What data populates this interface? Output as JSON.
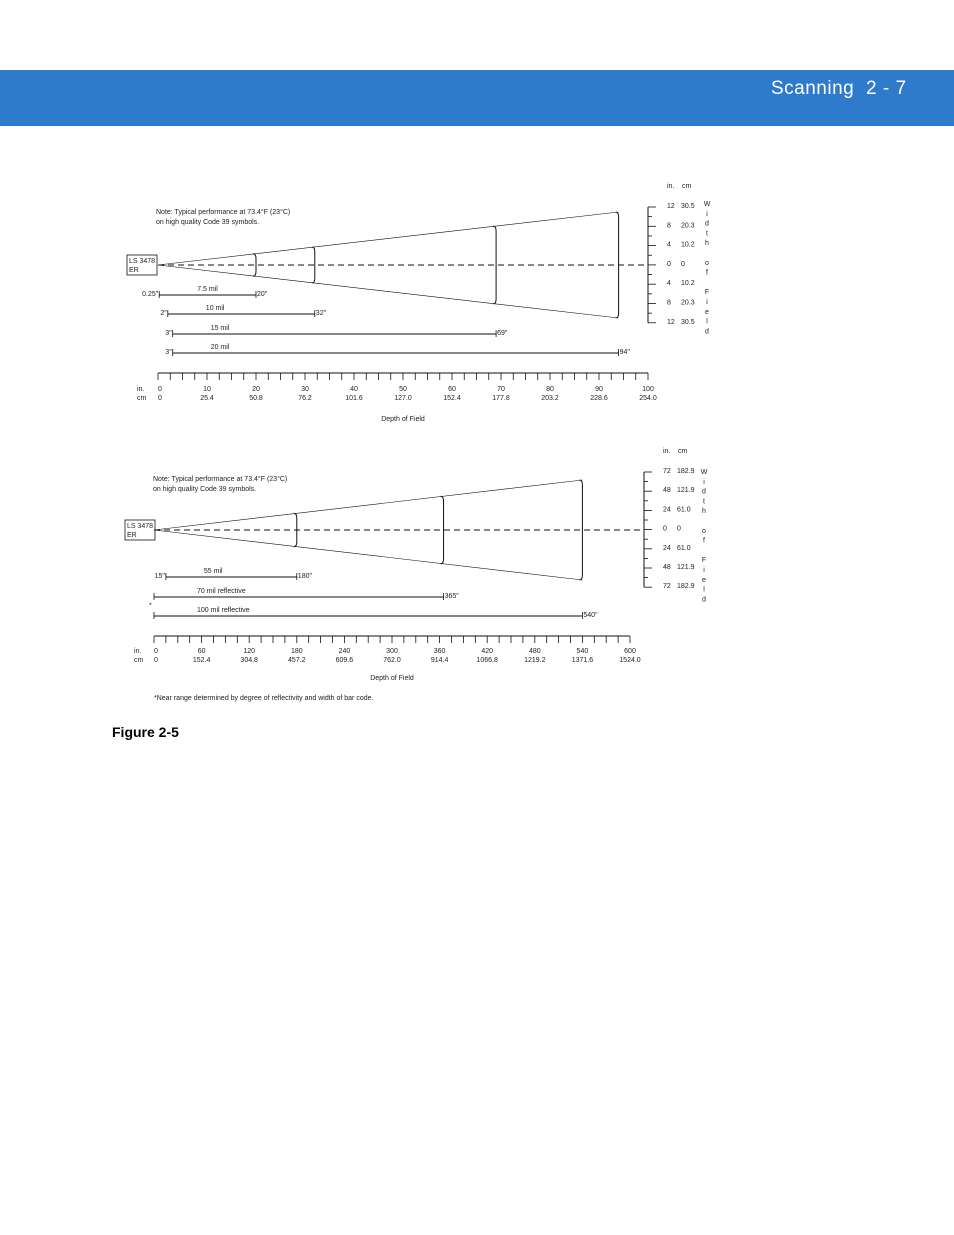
{
  "header": {
    "section": "Scanning",
    "page": "2 - 7",
    "color": "#2f7bcb"
  },
  "figure_label": "Figure 2-5",
  "diagrams": [
    {
      "note": [
        "Note: Typical performance at 73.4°F (23°C)",
        "on high quality Code 39 symbols."
      ],
      "scanner_label": [
        "LS 3478",
        "ER"
      ],
      "x_axis": {
        "min": 0,
        "max": 100,
        "minor_step": 2.5,
        "label": "Depth of Field",
        "unit_in": "in.",
        "unit_cm": "cm",
        "ticks_in": [
          "0",
          "10",
          "20",
          "30",
          "40",
          "50",
          "60",
          "70",
          "80",
          "90",
          "100"
        ],
        "ticks_cm": [
          "0",
          "25.4",
          "50.8",
          "76.2",
          "101.6",
          "127.0",
          "152.4",
          "177.8",
          "203.2",
          "228.6",
          "254.0"
        ]
      },
      "width_axis": {
        "unit_in": "in.",
        "unit_cm": "cm",
        "title_letters": [
          "W",
          "i",
          "d",
          "t",
          "h",
          "",
          "o",
          "f",
          "",
          "F",
          "i",
          "e",
          "l",
          "d"
        ],
        "ticks_in": [
          "12",
          "8",
          "4",
          "0",
          "4",
          "8",
          "12"
        ],
        "ticks_cm": [
          "30.5",
          "20.3",
          "10.2",
          "0",
          "10.2",
          "20.3",
          "30.5"
        ]
      },
      "beam_end": 94,
      "arcs": [
        20,
        32,
        69,
        94
      ],
      "ranges": [
        {
          "label": "7.5 mil",
          "near": 0.25,
          "far": 20,
          "near_label": "0.25\"",
          "far_label": "20\""
        },
        {
          "label": "10 mil",
          "near": 2,
          "far": 32,
          "near_label": "2\"",
          "far_label": "32\""
        },
        {
          "label": "15 mil",
          "near": 3,
          "far": 69,
          "near_label": "3\"",
          "far_label": "69\""
        },
        {
          "label": "20 mil",
          "near": 3,
          "far": 94,
          "near_label": "3\"",
          "far_label": "94\""
        }
      ]
    },
    {
      "note": [
        "Note: Typical performance at 73.4°F (23°C)",
        "on high quality Code 39 symbols."
      ],
      "scanner_label": [
        "LS 3478",
        "ER"
      ],
      "x_axis": {
        "min": 0,
        "max": 600,
        "minor_step": 15,
        "label": "Depth of Field",
        "unit_in": "in.",
        "unit_cm": "cm",
        "ticks_in": [
          "0",
          "60",
          "120",
          "180",
          "240",
          "300",
          "360",
          "420",
          "480",
          "540",
          "600"
        ],
        "ticks_cm": [
          "0",
          "152.4",
          "304.8",
          "457.2",
          "609.6",
          "762.0",
          "914.4",
          "1066.8",
          "1219.2",
          "1371.6",
          "1524.0"
        ]
      },
      "width_axis": {
        "unit_in": "in.",
        "unit_cm": "cm",
        "title_letters": [
          "W",
          "i",
          "d",
          "t",
          "h",
          "",
          "o",
          "f",
          "",
          "F",
          "i",
          "e",
          "l",
          "d"
        ],
        "ticks_in": [
          "72",
          "48",
          "24",
          "0",
          "24",
          "48",
          "72"
        ],
        "ticks_cm": [
          "182.9",
          "121.9",
          "61.0",
          "0",
          "61.0",
          "121.9",
          "182.9"
        ]
      },
      "beam_end": 540,
      "arcs": [
        180,
        365,
        540
      ],
      "ranges": [
        {
          "label": "55 mil",
          "near": 15,
          "far": 180,
          "near_label": "15\"",
          "far_label": "180\""
        },
        {
          "label": "70 mil reflective",
          "near": 0,
          "far": 365,
          "near_label": "",
          "far_label": "365\""
        },
        {
          "label": "100 mil reflective",
          "near": 0,
          "far": 540,
          "near_label": "",
          "far_label": "540\""
        }
      ],
      "asterisk": "*",
      "footnote": "*Near range determined by degree of reflectivity and width of bar code."
    }
  ]
}
